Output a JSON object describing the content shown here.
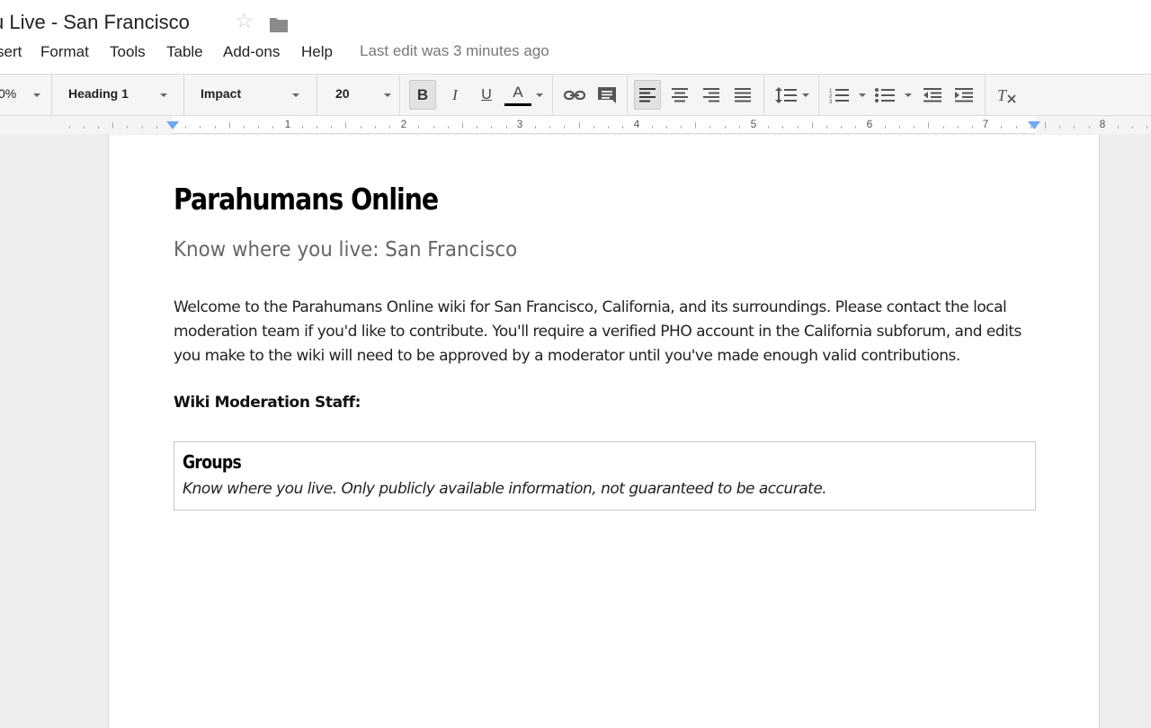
{
  "window": {
    "doc_title": "u Live - San Francisco",
    "last_edit": "Last edit was 3 minutes ago"
  },
  "menu": {
    "items": [
      "sert",
      "Format",
      "Tools",
      "Table",
      "Add-ons",
      "Help"
    ]
  },
  "toolbar": {
    "zoom": "0%",
    "style": "Heading 1",
    "font": "Impact",
    "size": "20",
    "bold_label": "B",
    "italic_label": "I",
    "underline_label": "U",
    "text_color_label": "A",
    "text_color": "#000000"
  },
  "ruler": {
    "numbers": [
      "1",
      "2",
      "3",
      "4",
      "5",
      "6",
      "7",
      "8"
    ]
  },
  "document": {
    "heading": "Parahumans Online",
    "subtitle": "Know where you live: San Francisco",
    "paragraph": "Welcome to the Parahumans Online wiki for San Francisco, California, and its surroundings. Please contact the local moderation team if you'd like to contribute. You'll require a verified PHO account in the California subforum, and edits you make to the wiki will need to be approved by a moderator until you've made enough valid contributions.",
    "staff_label": "Wiki Moderation Staff:",
    "table": {
      "title": "Groups",
      "description": "Know where you live. Only publicly available information, not guaranteed to be accurate."
    }
  }
}
